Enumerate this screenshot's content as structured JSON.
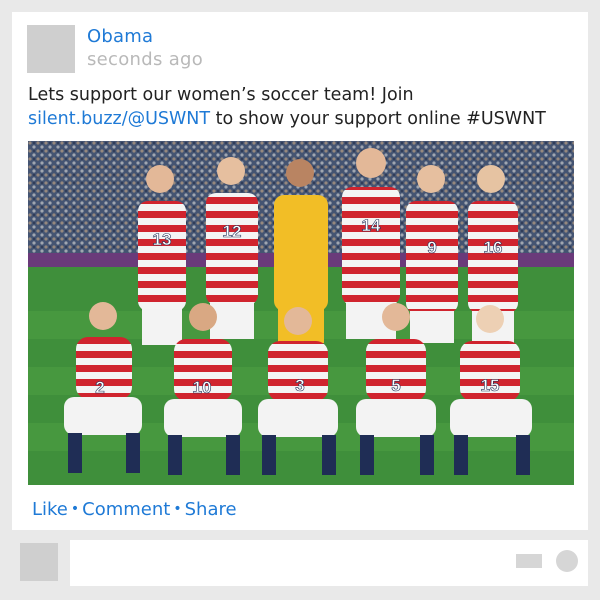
{
  "post": {
    "author": "Obama",
    "timestamp": "seconds ago",
    "text_prefix": "Lets support our women’s soccer team! Join",
    "link_text": "silent.buzz/@USWNT",
    "text_suffix": " to show your support online #USWNT",
    "photo_icon": "team-photo",
    "jersey_numbers_back": [
      "13",
      "12",
      "",
      "14",
      "9",
      "16"
    ],
    "jersey_numbers_front": [
      "2",
      "10",
      "3",
      "5",
      "15"
    ]
  },
  "actions": {
    "like": "Like",
    "comment": "Comment",
    "share": "Share",
    "separator": "•"
  },
  "composer": {
    "input_value": ""
  },
  "colors": {
    "link": "#1f7ad6",
    "muted": "#b9b9b9",
    "background": "#e9e9e9",
    "placeholder": "#cfcfcf"
  }
}
